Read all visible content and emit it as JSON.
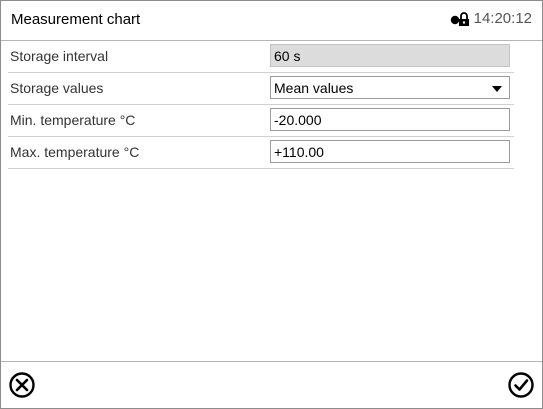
{
  "header": {
    "title": "Measurement chart",
    "time": "14:20:12",
    "lock_icon": "user-lock-icon"
  },
  "rows": [
    {
      "label": "Storage interval",
      "value": "60 s",
      "type": "readonly"
    },
    {
      "label": "Storage values",
      "value": "Mean values",
      "type": "dropdown"
    },
    {
      "label": "Min. temperature °C",
      "value": "-20.000",
      "type": "input"
    },
    {
      "label": "Max. temperature °C",
      "value": "+110.00",
      "type": "input"
    }
  ],
  "footer": {
    "cancel_icon": "cancel-icon",
    "confirm_icon": "checkmark-icon"
  }
}
